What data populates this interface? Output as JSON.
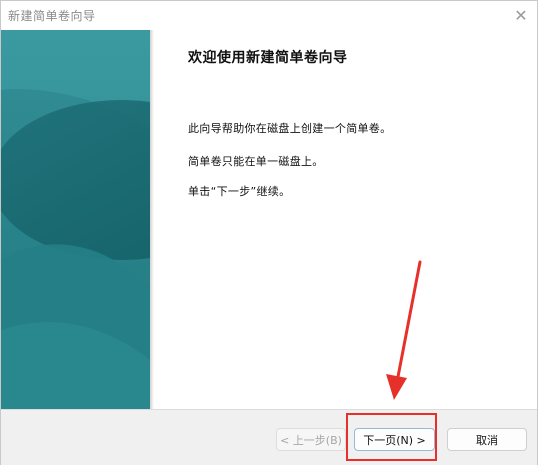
{
  "window": {
    "title": "新建简单卷向导",
    "close_glyph": "✕"
  },
  "content": {
    "heading": "欢迎使用新建简单卷向导",
    "paragraphs": [
      "此向导帮助你在磁盘上创建一个简单卷。",
      "简单卷只能在单一磁盘上。",
      "单击“下一步”继续。"
    ]
  },
  "footer": {
    "back_label": "< 上一步(B)",
    "next_label": "下一页(N) >",
    "cancel_label": "取消"
  },
  "annotation": {
    "color": "#e8302a"
  },
  "colors": {
    "side_panel": "#2a858c"
  }
}
